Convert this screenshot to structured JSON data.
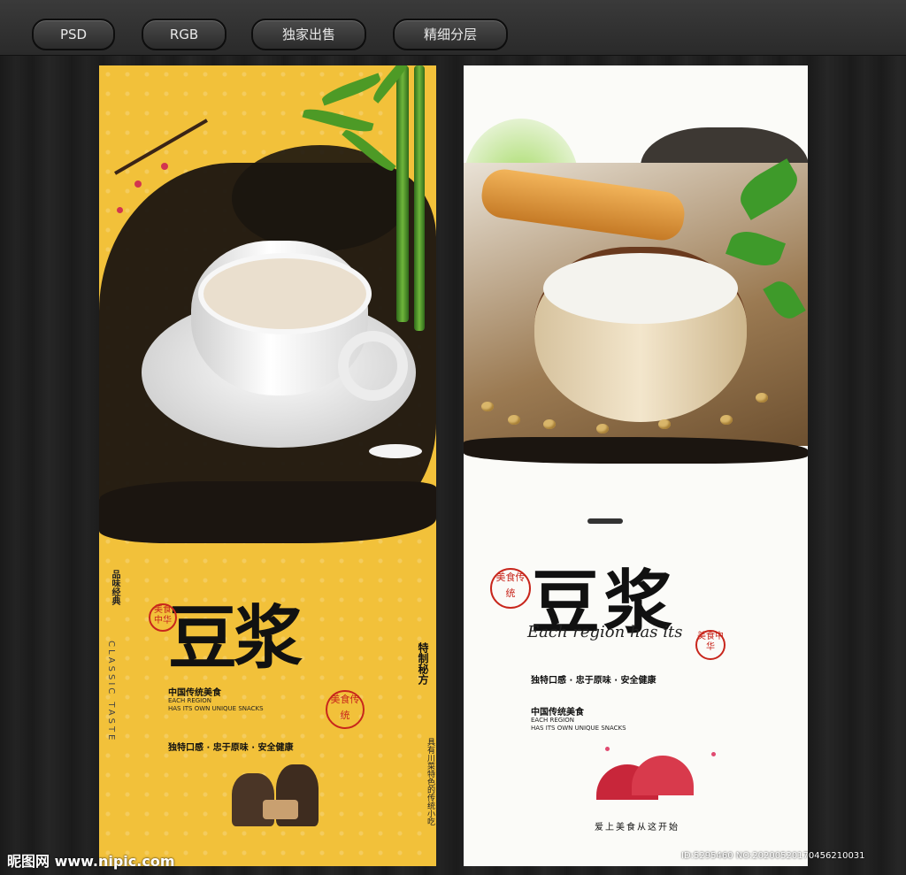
{
  "tags": [
    "PSD",
    "RGB",
    "独家出售",
    "精细分层"
  ],
  "left_poster": {
    "title": "豆浆",
    "vertical_1": "品味经典",
    "vertical_2": "CLASSIC TASTE",
    "vertical_3": "特制秘方",
    "vertical_4": "具有川菜特色的传统小吃",
    "headline": "中国传统美食",
    "sub_1": "EACH REGION",
    "sub_2": "HAS ITS OWN UNIQUE SNACKS",
    "slogan": "独特口感 · 忠于原味 · 安全健康",
    "seal_small": "美食中华",
    "seal_big": "美食传统"
  },
  "right_poster": {
    "title": "豆浆",
    "script": "Each region has its",
    "slogan": "独特口感 · 忠于原味 · 安全健康",
    "headline": "中国传统美食",
    "sub_1": "EACH REGION",
    "sub_2": "HAS ITS OWN UNIQUE SNACKS",
    "bottom_line": "爱上美食从这开始",
    "seal_left": "美食传统",
    "seal_right": "美食中华"
  },
  "watermark_left": "昵图网 www.nipic.com",
  "watermark_right": "ID:5295460 NO:20200520170456210031",
  "colors": {
    "yellow": "#f2c13a",
    "ink": "#1b1510",
    "seal": "#c8261c"
  }
}
